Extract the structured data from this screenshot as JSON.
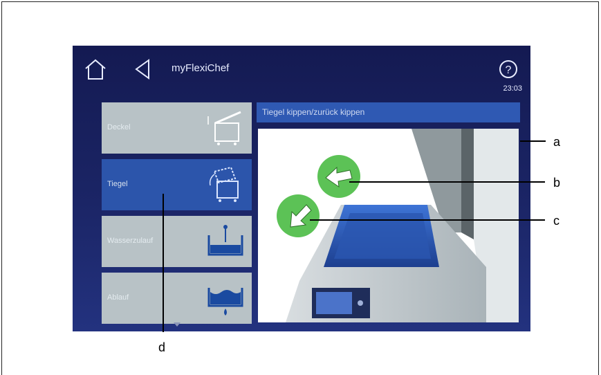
{
  "app": {
    "title": "myFlexiChef",
    "time": "23:03"
  },
  "menu": {
    "items": [
      {
        "label": "Deckel",
        "icon": "lid-tilt-icon",
        "active": false
      },
      {
        "label": "Tiegel",
        "icon": "pan-tilt-icon",
        "active": true
      },
      {
        "label": "Wasserzulauf",
        "icon": "water-inlet-icon",
        "active": false
      },
      {
        "label": "Ablauf",
        "icon": "drain-icon",
        "active": false
      }
    ]
  },
  "panel": {
    "title": "Tiegel kippen/zurück kippen"
  },
  "callouts": {
    "a": "a",
    "b": "b",
    "c": "c",
    "d": "d"
  },
  "colors": {
    "accent": "#2c55ab",
    "screen_bg": "#1b2566",
    "inactive_item": "#b8c2c6",
    "green_button": "#5cc256"
  }
}
